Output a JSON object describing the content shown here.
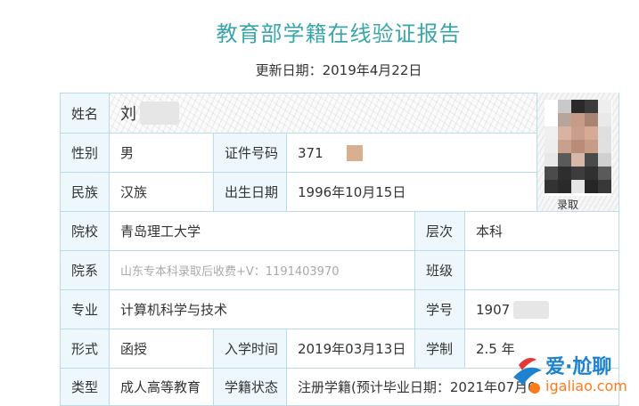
{
  "header": {
    "title": "教育部学籍在线验证报告",
    "update_date": "更新日期：2019年4月22日"
  },
  "fields": {
    "name_label": "姓名",
    "name_value": "刘",
    "gender_label": "性别",
    "gender_value": "男",
    "id_label": "证件号码",
    "id_value": "371",
    "ethnicity_label": "民族",
    "ethnicity_value": "汉族",
    "birth_label": "出生日期",
    "birth_value": "1996年10月15日",
    "school_label": "院校",
    "school_value": "青岛理工大学",
    "level_label": "层次",
    "level_value": "本科",
    "department_label": "院系",
    "department_value": "山东专本科录取后收费+V：1191403970",
    "class_label": "班级",
    "class_value": "",
    "major_label": "专业",
    "major_value": "计算机科学与技术",
    "student_no_label": "学号",
    "student_no_value": "1907",
    "form_label": "形式",
    "form_value": "函授",
    "enroll_label": "入学时间",
    "enroll_value": "2019年03月13日",
    "duration_label": "学制",
    "duration_value": "2.5 年",
    "type_label": "类型",
    "type_value": "成人高等教育",
    "status_label": "学籍状态",
    "status_value": "注册学籍(预计毕业日期：2021年07月0"
  },
  "photo": {
    "caption": "录取"
  },
  "watermark": {
    "brand": "爱·尬聊",
    "url": "igaliao.com"
  }
}
